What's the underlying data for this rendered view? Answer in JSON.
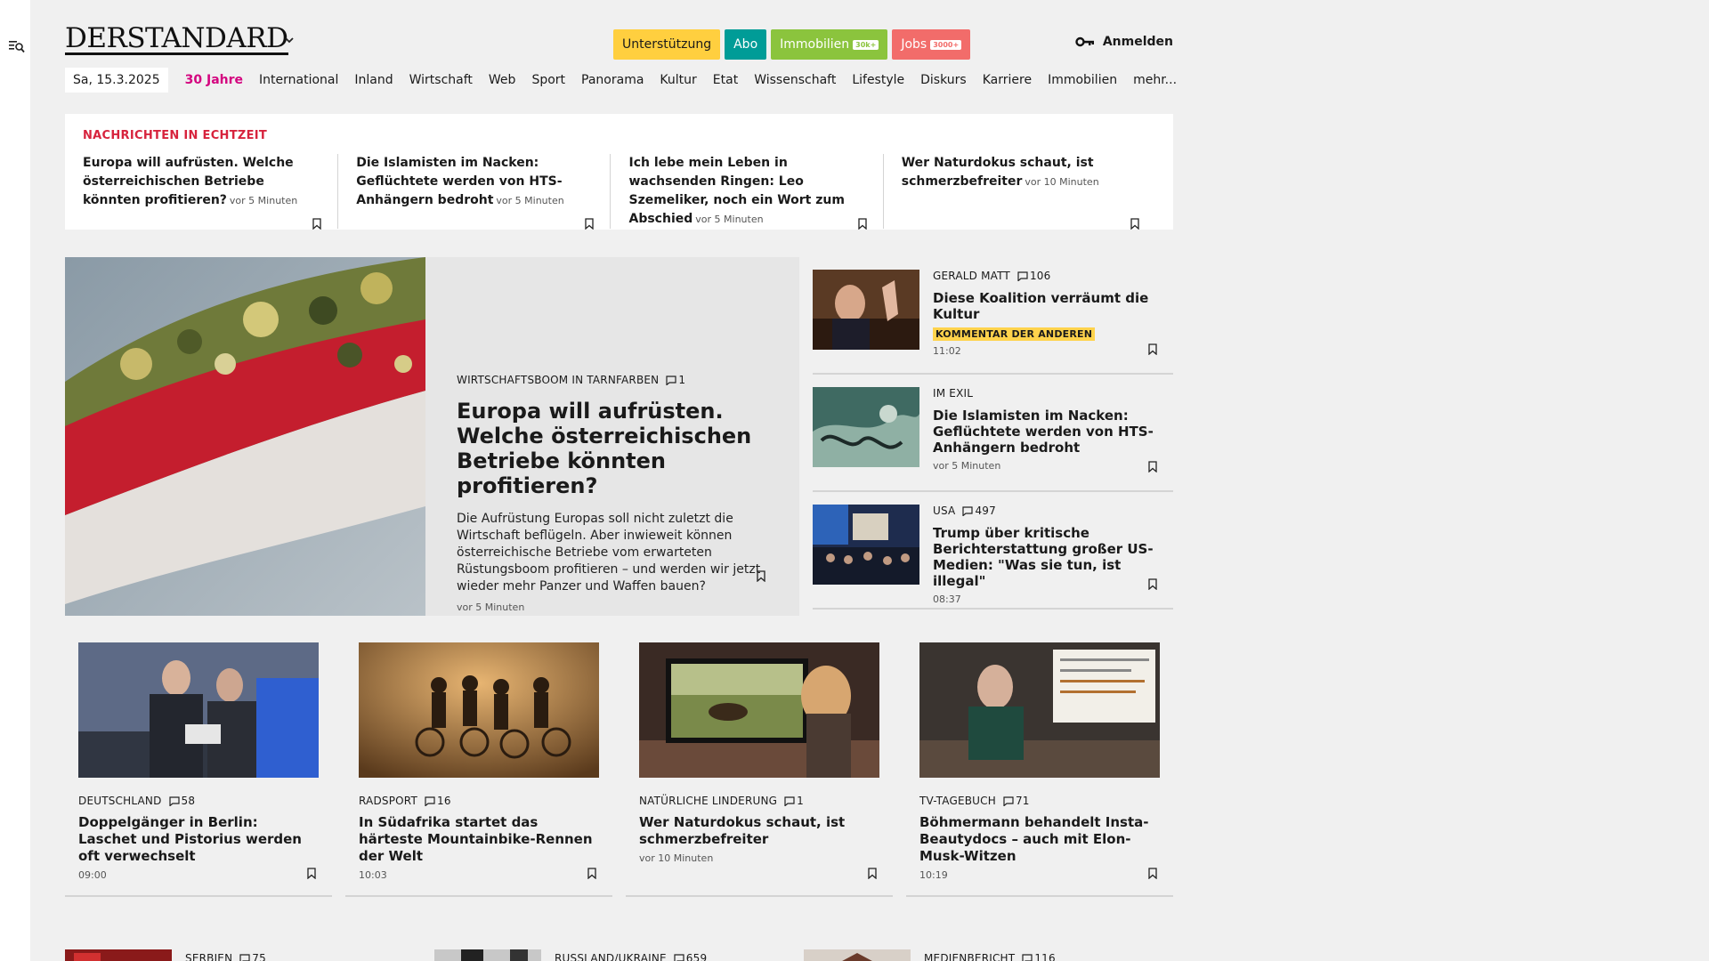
{
  "sidebar": {
    "icon": "search-menu-icon"
  },
  "header": {
    "logo": "DERSTANDARD",
    "pills": [
      {
        "label": "Unterstützung",
        "bg": "#ffcf3f",
        "fg": "#1a1a1a",
        "badge": ""
      },
      {
        "label": "Abo",
        "bg": "#009c97",
        "fg": "#ffffff",
        "badge": ""
      },
      {
        "label": "Immobilien",
        "bg": "#8bc43d",
        "fg": "#ffffff",
        "badge": "30k+"
      },
      {
        "label": "Jobs",
        "bg": "#f26c6a",
        "fg": "#ffffff",
        "badge": "3000+"
      }
    ],
    "login": "Anmelden"
  },
  "nav": {
    "date": "Sa, 15.3.2025",
    "items": [
      "30 Jahre",
      "International",
      "Inland",
      "Wirtschaft",
      "Web",
      "Sport",
      "Panorama",
      "Kultur",
      "Etat",
      "Wissenschaft",
      "Lifestyle",
      "Diskurs",
      "Karriere",
      "Immobilien",
      "mehr..."
    ]
  },
  "ticker": {
    "heading": "NACHRICHTEN IN ECHTZEIT",
    "items": [
      {
        "title": "Europa will aufrüsten. Welche österreichischen Betriebe könnten profitieren?",
        "time": "vor 5 Minuten"
      },
      {
        "title": "Die Islamisten im Nacken: Geflüchtete werden von HTS-Anhängern bedroht",
        "time": "vor 5 Minuten"
      },
      {
        "title": "Ich lebe mein Leben in wachsenden Ringen: Leo Szemeliker, noch ein Wort zum Abschied",
        "time": "vor 5 Minuten"
      },
      {
        "title": "Wer Naturdokus schaut, ist schmerzbefreiter",
        "time": "vor 10 Minuten"
      }
    ]
  },
  "hero": {
    "kicker": "WIRTSCHAFTSBOOM IN TARNFARBEN",
    "comments": "1",
    "title": "Europa will aufrüsten. Welche österreichischen Betriebe könnten profitieren?",
    "text": "Die Aufrüstung Europas soll nicht zuletzt die Wirtschaft beflügeln. Aber inwieweit können österreichische Betriebe vom erwarteten Rüstungsboom profitieren – und werden wir jetzt wieder mehr Panzer und Waffen bauen?",
    "time": "vor 5 Minuten"
  },
  "side": [
    {
      "kicker": "GERALD MATT",
      "comments": "106",
      "title": "Diese Koalition verräumt die Kultur",
      "badge": "KOMMENTAR DER ANDEREN",
      "time": "11:02"
    },
    {
      "kicker": "IM EXIL",
      "comments": "",
      "title": "Die Islamisten im Nacken: Geflüchtete werden von HTS-Anhängern bedroht",
      "badge": "",
      "time": "vor 5 Minuten"
    },
    {
      "kicker": "USA",
      "comments": "497",
      "title": "Trump über kritische Berichterstattung großer US-Medien: \"Was sie tun, ist illegal\"",
      "badge": "",
      "time": "08:37"
    }
  ],
  "grid": [
    {
      "kicker": "DEUTSCHLAND",
      "comments": "58",
      "title": "Doppelgänger in Berlin: Laschet und Pistorius werden oft verwechselt",
      "time": "09:00"
    },
    {
      "kicker": "RADSPORT",
      "comments": "16",
      "title": "In Südafrika startet das härteste Mountainbike-Rennen der Welt",
      "time": "10:03"
    },
    {
      "kicker": "NATÜRLICHE LINDERUNG",
      "comments": "1",
      "title": "Wer Naturdokus schaut, ist schmerzbefreiter",
      "time": "vor 10 Minuten"
    },
    {
      "kicker": "TV-TAGEBUCH",
      "comments": "71",
      "title": "Böhmermann behandelt Insta-Beautydocs – auch mit Elon-Musk-Witzen",
      "time": "10:19"
    }
  ],
  "bottom": [
    {
      "kicker": "SERBIEN",
      "comments": "75"
    },
    {
      "kicker": "RUSSLAND/UKRAINE",
      "comments": "659"
    },
    {
      "kicker": "MEDIENBERICHT",
      "comments": "116"
    }
  ]
}
